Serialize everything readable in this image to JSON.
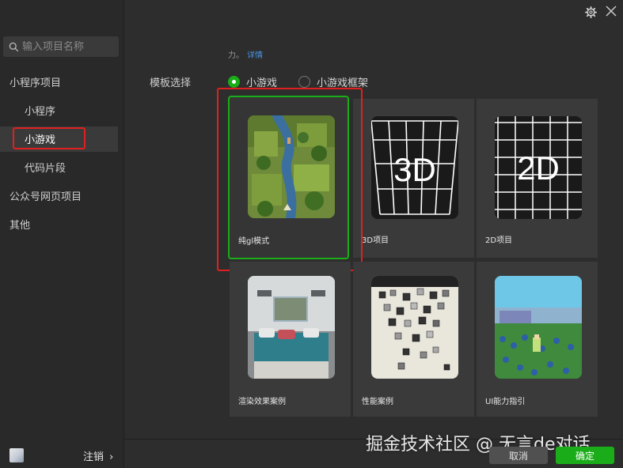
{
  "search": {
    "placeholder": "输入项目名称"
  },
  "sidebar": {
    "items": [
      {
        "label": "小程序项目"
      },
      {
        "label": "小程序"
      },
      {
        "label": "小游戏"
      },
      {
        "label": "代码片段"
      },
      {
        "label": "公众号网页项目"
      },
      {
        "label": "其他"
      }
    ],
    "logout_label": "注销",
    "logout_arrow": "›"
  },
  "header": {
    "tip_text": "力。",
    "tip_link": "详情",
    "template_label": "模板选择",
    "radio_options": [
      {
        "label": "小游戏",
        "selected": true
      },
      {
        "label": "小游戏框架",
        "selected": false
      }
    ]
  },
  "templates": [
    {
      "label": "纯gl模式",
      "selected": true
    },
    {
      "label": "3D项目",
      "thumb_text": "3D"
    },
    {
      "label": "2D项目",
      "thumb_text": "2D"
    },
    {
      "label": "渲染效果案例"
    },
    {
      "label": "性能案例"
    },
    {
      "label": "UI能力指引"
    }
  ],
  "footer": {
    "cancel_label": "取消",
    "ok_label": "确定",
    "watermark": "掘金技术社区 @ 无言de对话"
  },
  "colors": {
    "accent": "#1aad19",
    "highlight": "#e02020",
    "link": "#4a95e8"
  }
}
